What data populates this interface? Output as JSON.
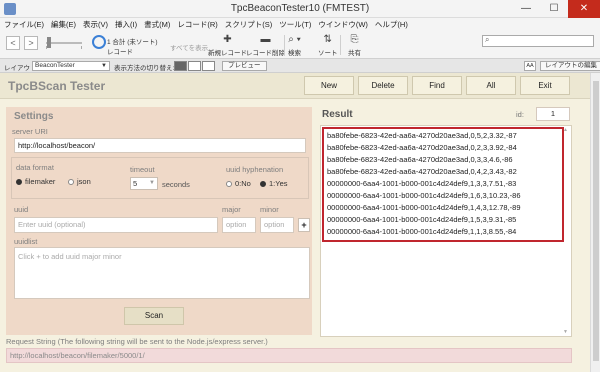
{
  "window": {
    "title": "TpcBeaconTester10 (FMTEST)",
    "min": "—",
    "max": "☐",
    "close": "✕"
  },
  "menu": [
    "ファイル(E)",
    "編集(E)",
    "表示(V)",
    "挿入(I)",
    "書式(M)",
    "レコード(R)",
    "スクリプト(S)",
    "ツール(T)",
    "ウインドウ(W)",
    "ヘルプ(H)"
  ],
  "toolbar": {
    "prev": "<",
    "next": ">",
    "record_count": "1 合計 (未ソート)",
    "record_label": "レコード",
    "show_all": "すべてを表示",
    "new_record": "新規レコード",
    "delete_record": "レコード削除",
    "search": "検索",
    "sort": "ソート",
    "share": "共有",
    "icons": {
      "new": "plus-icon",
      "delete": "minus-icon",
      "search": "magnifier-icon",
      "sort": "sort-icon",
      "share": "share-icon"
    }
  },
  "layoutbar": {
    "layout_label": "レイアウト:",
    "layout_value": "BeaconTester",
    "view_label": "表示方法の切り替え:",
    "preview": "プレビュー",
    "aa": "AA",
    "edit_layout": "レイアウトの編集"
  },
  "header": {
    "app_title": "TpcBScan Tester",
    "buttons": {
      "new": "New",
      "delete": "Delete",
      "find": "Find",
      "all": "All",
      "exit": "Exit"
    }
  },
  "settings": {
    "title": "Settings",
    "server_uri_label": "server URI",
    "server_uri": "http://localhost/beacon/",
    "data_format_label": "data format",
    "format_filemaker": "filemaker",
    "format_json": "json",
    "timeout_label": "timeout",
    "timeout_value": "5",
    "timeout_unit": "seconds",
    "uuid_hyphenation_label": "uuid hyphenation",
    "hyphen_no": "0:No",
    "hyphen_yes": "1:Yes",
    "uuid_label": "uuid",
    "uuid_placeholder": "Enter uuid (optional)",
    "major_label": "major",
    "major_placeholder": "option",
    "minor_label": "minor",
    "minor_placeholder": "option",
    "add": "+",
    "uuidlist_label": "uuidlist",
    "uuidlist_placeholder": "Click + to add uuid major minor",
    "scan": "Scan"
  },
  "result": {
    "title": "Result",
    "id_label": "id:",
    "id_value": "1",
    "lines": [
      "ba80febe-6823-42ed-aa6a-4270d20ae3ad,0,5,2,3.32,-87",
      "ba80febe-6823-42ed-aa6a-4270d20ae3ad,0,2,3,3.92,-84",
      "ba80febe-6823-42ed-aa6a-4270d20ae3ad,0,3,3,4.6,-86",
      "ba80febe-6823-42ed-aa6a-4270d20ae3ad,0,4,2,3.43,-82",
      "00000000-6aa4-1001-b000-001c4d24def9,1,3,3,7.51,-83",
      "00000000-6aa4-1001-b000-001c4d24def9,1,6,3,10.23,-86",
      "00000000-6aa4-1001-b000-001c4d24def9,1,4,3,12.78,-89",
      "00000000-6aa4-1001-b000-001c4d24def9,1,5,3,9.31,-85",
      "00000000-6aa4-1001-b000-001c4d24def9,1,1,3,8.55,-84"
    ]
  },
  "request": {
    "label": "Request String (The following string will be sent to the Node.js/express server.)",
    "value": "http://localhost/beacon/filemaker/5000/1/"
  },
  "colors": {
    "accent": "#c0262e",
    "panel": "#efd9c8",
    "background": "#f5f1e0"
  }
}
